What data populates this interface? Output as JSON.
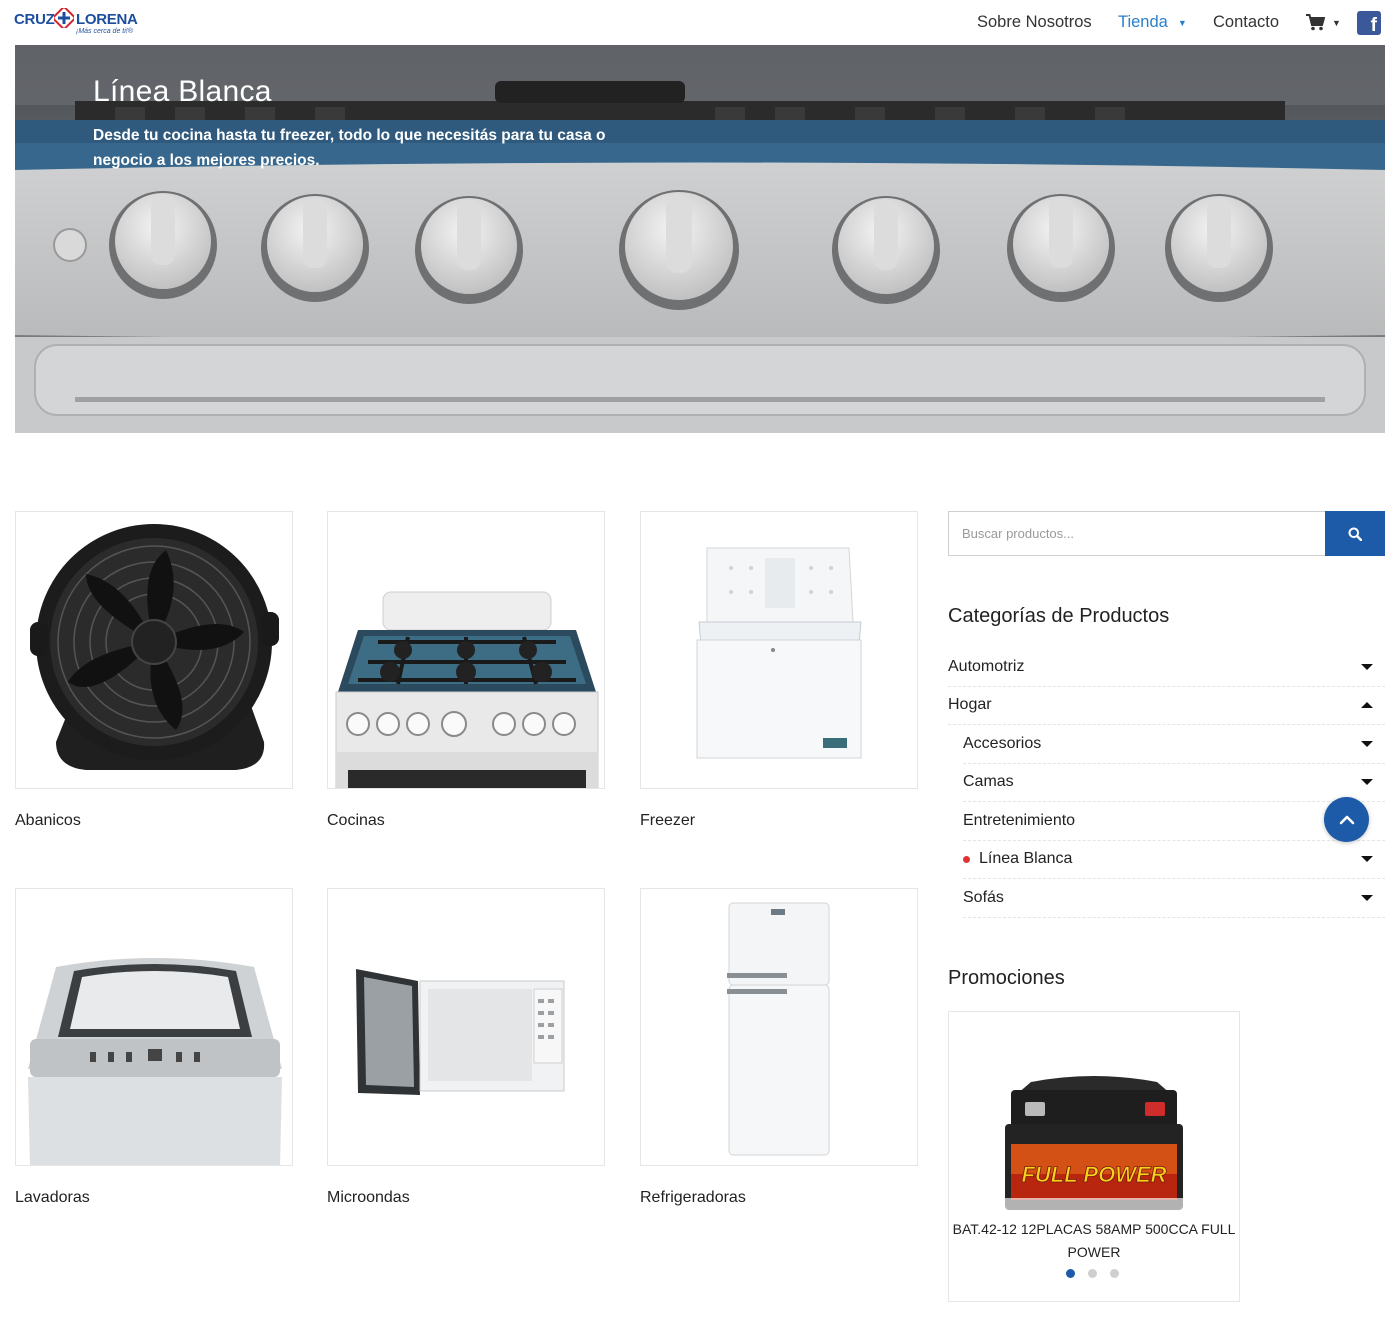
{
  "brand": {
    "name_left": "CRUZ",
    "name_right": "LORENA",
    "tagline": "¡Más cerca de ti!®"
  },
  "nav": {
    "about": "Sobre Nosotros",
    "shop": "Tienda",
    "contact": "Contacto",
    "facebook_icon": "f"
  },
  "hero": {
    "title": "Línea Blanca",
    "subtitle": "Desde tu cocina hasta tu freezer, todo lo que necesitás para tu casa o negocio a los mejores precios."
  },
  "products": [
    {
      "name": "Abanicos",
      "icon": "fan-image"
    },
    {
      "name": "Cocinas",
      "icon": "stove-image"
    },
    {
      "name": "Freezer",
      "icon": "freezer-image"
    },
    {
      "name": "Lavadoras",
      "icon": "washer-image"
    },
    {
      "name": "Microondas",
      "icon": "microwave-image"
    },
    {
      "name": "Refrigeradoras",
      "icon": "fridge-image"
    }
  ],
  "search": {
    "placeholder": "Buscar productos..."
  },
  "sidebar": {
    "categories_title": "Categorías de Productos",
    "categories": [
      {
        "label": "Automotriz",
        "expanded": false,
        "level": 0
      },
      {
        "label": "Hogar",
        "expanded": true,
        "level": 0
      },
      {
        "label": "Accesorios",
        "expanded": false,
        "level": 1
      },
      {
        "label": "Camas",
        "expanded": false,
        "level": 1
      },
      {
        "label": "Entretenimiento",
        "expanded": false,
        "level": 1
      },
      {
        "label": "Línea Blanca",
        "expanded": false,
        "level": 1,
        "current": true
      },
      {
        "label": "Sofás",
        "expanded": false,
        "level": 1
      }
    ],
    "promos_title": "Promociones",
    "promo": {
      "name": "BAT.42-12 12PLACAS 58AMP 500CCA FULL POWER",
      "brand_text": "FULL POWER",
      "slide_count": 3,
      "active_slide": 1
    }
  },
  "colors": {
    "accent": "#1d5ba8",
    "nav_active": "#2a7fc9",
    "current_dot": "#e03434"
  }
}
